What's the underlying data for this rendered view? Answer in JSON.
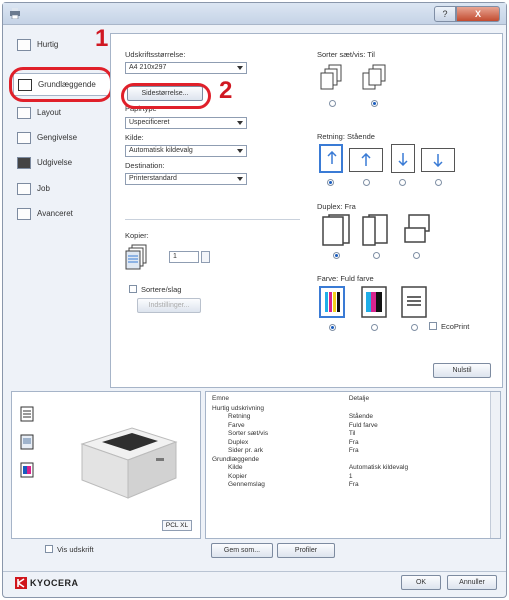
{
  "window": {
    "help_label": "?",
    "close_label": "X"
  },
  "nav": {
    "items": [
      {
        "label": "Hurtig",
        "icon": "quick-icon"
      },
      {
        "label": "Grundlæggende",
        "icon": "basic-icon"
      },
      {
        "label": "Layout",
        "icon": "layout-icon"
      },
      {
        "label": "Gengivelse",
        "icon": "imaging-icon"
      },
      {
        "label": "Udgivelse",
        "icon": "publishing-icon"
      },
      {
        "label": "Job",
        "icon": "job-icon"
      },
      {
        "label": "Avanceret",
        "icon": "advanced-icon"
      }
    ]
  },
  "basic": {
    "paper_size_label": "Udskriftsstørrelse:",
    "paper_size_value": "A4 210x297",
    "page_size_button": "Sidestørrelse...",
    "orientation_label": "Papirtype",
    "orientation_value": "Uspecificeret",
    "source_label": "Kilde:",
    "source_value": "Automatisk kildevalg",
    "destination_label": "Destination:",
    "destination_value": "Printerstandard",
    "copies_label": "Kopier:",
    "copies_value": "1",
    "collate_label": "Sortere/slag",
    "settings_button": "Indstillinger..."
  },
  "right": {
    "collate_title": "Sorter sæt/vis: Til",
    "orientation_title": "Retning: Stående",
    "duplex_title": "Duplex: Fra",
    "color_title": "Farve: Fuld farve",
    "ecoprint_label": "EcoPrint",
    "reset_button": "Nulstil"
  },
  "callouts": [
    "1",
    "2"
  ],
  "preview": {
    "pdl_label": "PCL XL"
  },
  "summary": {
    "headers": [
      "Emne",
      "Detalje"
    ],
    "rows": [
      [
        "Hurtig udskrivning",
        ""
      ],
      [
        "Retning",
        "Stående"
      ],
      [
        "Farve",
        "Fuld farve"
      ],
      [
        "Sorter sæt/vis",
        "Til"
      ],
      [
        "Duplex",
        "Fra"
      ],
      [
        "Sider pr. ark",
        "Fra"
      ],
      [
        "Grundlæggende",
        ""
      ],
      [
        "Kilde",
        "Automatisk kildevalg"
      ],
      [
        "Kopier",
        "1"
      ],
      [
        "Gennemslag",
        "Fra"
      ]
    ]
  },
  "bottom": {
    "view_label": "Vis udskrift",
    "save_as_button": "Gem som...",
    "profiles_button": "Profiler",
    "ok_button": "OK",
    "cancel_button": "Annuller"
  },
  "brand": {
    "name": "KYOCERA",
    "color": "#d0151b"
  }
}
